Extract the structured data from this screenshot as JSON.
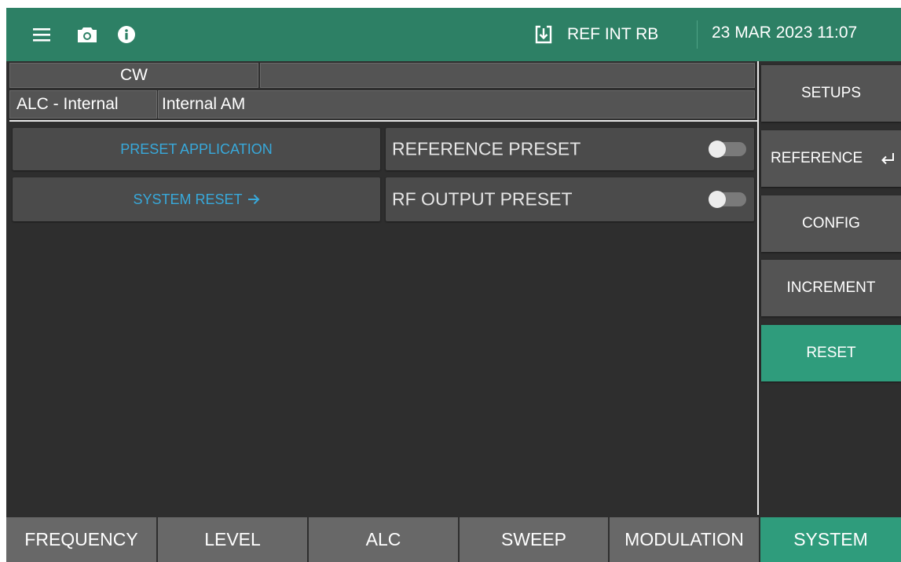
{
  "header": {
    "reference_status": "REF INT RB",
    "datetime": "23 MAR 2023 11:07",
    "icons": [
      "hamburger-menu-icon",
      "camera-icon",
      "info-icon",
      "reference-download-icon"
    ],
    "colors": {
      "header_bg": "#2d8065"
    }
  },
  "status_cells": {
    "mode": "CW",
    "mode_detail": "",
    "alc": "ALC - Internal",
    "modulation": "Internal AM"
  },
  "main": {
    "preset_application_label": "PRESET APPLICATION",
    "system_reset_label": "SYSTEM RESET",
    "system_reset_icon": "arrow-right-icon",
    "reference_preset": {
      "label": "REFERENCE PRESET",
      "enabled": false
    },
    "rf_output_preset": {
      "label": "RF OUTPUT PRESET",
      "enabled": false
    },
    "colors": {
      "link_text": "#38a9db"
    }
  },
  "sidebar": {
    "items": [
      {
        "label": "SETUPS",
        "active": false
      },
      {
        "label": "REFERENCE",
        "active": false,
        "icon": "return-icon"
      },
      {
        "label": "CONFIG",
        "active": false
      },
      {
        "label": "INCREMENT",
        "active": false
      },
      {
        "label": "RESET",
        "active": true
      }
    ]
  },
  "tabs": [
    {
      "label": "FREQUENCY",
      "active": false
    },
    {
      "label": "LEVEL",
      "active": false
    },
    {
      "label": "ALC",
      "active": false
    },
    {
      "label": "SWEEP",
      "active": false
    },
    {
      "label": "MODULATION",
      "active": false
    },
    {
      "label": "SYSTEM",
      "active": true
    }
  ],
  "colors": {
    "accent": "#2f9c7c",
    "background": "#2e2e2e"
  }
}
